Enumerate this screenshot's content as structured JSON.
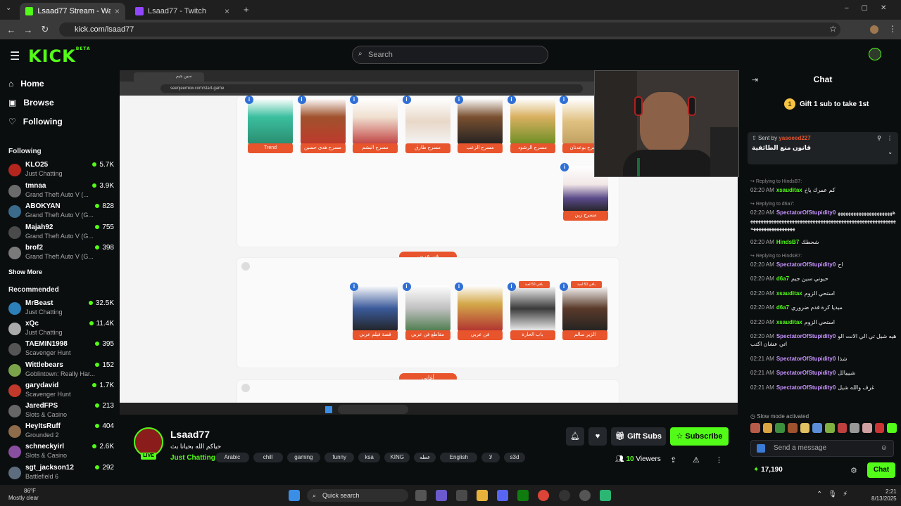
{
  "browser": {
    "tabs": [
      {
        "label": "Lsaad77 Stream - Watch Live o",
        "active": true,
        "color": "#53fc18"
      },
      {
        "label": "Lsaad77 - Twitch",
        "active": false,
        "color": "#9146ff"
      }
    ],
    "url": "kick.com/lsaad77"
  },
  "header": {
    "logo": "KICK",
    "logo_badge": "BETA",
    "search_placeholder": "Search"
  },
  "sidebar": {
    "nav": [
      {
        "label": "Home",
        "icon": "home-icon"
      },
      {
        "label": "Browse",
        "icon": "browse-icon"
      },
      {
        "label": "Following",
        "icon": "heart-icon"
      }
    ],
    "following_title": "Following",
    "following": [
      {
        "name": "KLO25",
        "category": "Just Chatting",
        "viewers": "5.7K",
        "color": "#b3261e"
      },
      {
        "name": "tmnaa",
        "category": "Grand Theft Auto V (...",
        "viewers": "3.9K",
        "color": "#6b6b6b"
      },
      {
        "name": "ABOKYAN",
        "category": "Grand Theft Auto V (G...",
        "viewers": "828",
        "color": "#3a6b8a"
      },
      {
        "name": "Majah92",
        "category": "Grand Theft Auto V (G...",
        "viewers": "755",
        "color": "#4a4a4a"
      },
      {
        "name": "brof2",
        "category": "Grand Theft Auto V (G...",
        "viewers": "398",
        "color": "#7a7a7a"
      }
    ],
    "show_more": "Show More",
    "recommended_title": "Recommended",
    "recommended": [
      {
        "name": "MrBeast",
        "category": "Just Chatting",
        "viewers": "32.5K",
        "color": "#2c7fb8"
      },
      {
        "name": "xQc",
        "category": "Just Chatting",
        "viewers": "11.4K",
        "color": "#aaaaaa"
      },
      {
        "name": "TAEMIN1998",
        "category": "Scavenger Hunt",
        "viewers": "395",
        "color": "#555555"
      },
      {
        "name": "Wittlebears",
        "category": "Goblintown: Really Har...",
        "viewers": "152",
        "color": "#7aa34a"
      },
      {
        "name": "garydavid",
        "category": "Scavenger Hunt",
        "viewers": "1.7K",
        "color": "#c0392b"
      },
      {
        "name": "JaredFPS",
        "category": "Slots & Casino",
        "viewers": "213",
        "color": "#666666"
      },
      {
        "name": "HeyItsRuff",
        "category": "Grounded 2",
        "viewers": "404",
        "color": "#8e6b4a"
      },
      {
        "name": "schneckyirl",
        "category": "Slots & Casino",
        "viewers": "2.6K",
        "color": "#884ea0"
      },
      {
        "name": "sgt_jackson12",
        "category": "Battlefield 6",
        "viewers": "292",
        "color": "#5d6d7e"
      }
    ]
  },
  "stream_view": {
    "inner_tab": "سين جيم",
    "inner_url": "seenjeemkw.com/start-game",
    "top_cards": [
      "Trend",
      "مسرح هدى حسين",
      "مسرح البشم",
      "مسرح طارق",
      "مسرح الزعب",
      "مسرح الرشود",
      "مسرح بوعدنان"
    ],
    "extra_card": "مسرح زين",
    "section1": "فن عربي",
    "section1_cards": [
      "قصة فيلم عربي",
      "مقاطع فن عربي",
      "فن عربي",
      "باب الحارة",
      "الزير سالم"
    ],
    "section2": "أغاني",
    "card_ribbon": "باقي 50 لعبة"
  },
  "chat": {
    "title": "Chat",
    "gift_text": "Gift 1 sub to take 1st",
    "gift_count": "1",
    "pinned_sender_label": "Sent by",
    "pinned_sender": "yasoeed227",
    "pinned_text": "قانون منع الطائفية",
    "messages": [
      {
        "reply": "Replying to HindsB7: ",
        "time": "02:20 AM",
        "user": "xsauditax",
        "color": "#53fc18",
        "text": "كم عمرك ياخ"
      },
      {
        "reply": "Replying to d6a7: ",
        "time": "02:20 AM",
        "user": "SpectatorOfStupidity0",
        "color": "#c793ff",
        "text": "ههههههههههههههههههههههههههههههههههههههههههههههههههههههههههههههههههههههههههههههههههههههههههههههه"
      },
      {
        "reply": "",
        "time": "02:20 AM",
        "user": "HindsB7",
        "color": "#53fc18",
        "text": "شحطك"
      },
      {
        "reply": "Replying to HindsB7: ",
        "time": "02:20 AM",
        "user": "SpectatorOfStupidity0",
        "color": "#c793ff",
        "text": "اح"
      },
      {
        "reply": "",
        "time": "02:20 AM",
        "user": "d6a7",
        "color": "#53fc18",
        "text": "حيوني سين جيم"
      },
      {
        "reply": "",
        "time": "02:20 AM",
        "user": "xsauditax",
        "color": "#53fc18",
        "text": "استحي الزوم"
      },
      {
        "reply": "",
        "time": "02:20 AM",
        "user": "d6a7",
        "color": "#53fc18",
        "text": "ميديا كرة قدم ضروري"
      },
      {
        "reply": "",
        "time": "02:20 AM",
        "user": "xsauditax",
        "color": "#53fc18",
        "text": "استحي الزوم"
      },
      {
        "reply": "",
        "time": "02:20 AM",
        "user": "SpectatorOfStupidity0",
        "color": "#c793ff",
        "text": "هيه شيل تي الي الانت الواتي عشان اكتب"
      },
      {
        "reply": "",
        "time": "02:21 AM",
        "user": "SpectatorOfStupidity0",
        "color": "#c793ff",
        "text": "شذا"
      },
      {
        "reply": "",
        "time": "02:21 AM",
        "user": "SpectatorOfStupidity0",
        "color": "#c793ff",
        "text": "شيييالل"
      },
      {
        "reply": "",
        "time": "02:21 AM",
        "user": "SpectatorOfStupidity0",
        "color": "#c793ff",
        "text": "غرف والله شيل"
      }
    ],
    "slow_mode": "Slow mode activated",
    "send_placeholder": "Send a message",
    "points": "17,190",
    "chat_button": "Chat"
  },
  "stream_info": {
    "streamer": "Lsaad77",
    "title": "حياكم الله بحيانا بث",
    "live_badge": "LIVE",
    "category": "Just Chatting",
    "tags": [
      "Arabic",
      "chill",
      "gaming",
      "funny",
      "ksa",
      "KING",
      "عطه",
      "English",
      "لا",
      "s3d"
    ],
    "gift_subs": "Gift Subs",
    "subscribe": "Subscribe",
    "viewers_count": "10",
    "viewers_label": "Viewers"
  },
  "taskbar": {
    "temp": "86°F",
    "weather": "Mostly clear",
    "search": "Quick search",
    "time": "2:21",
    "date": "8/13/2025"
  }
}
